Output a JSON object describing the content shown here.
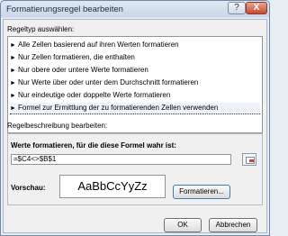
{
  "window": {
    "title": "Formatierungsregel bearbeiten",
    "help": "?",
    "close": "X"
  },
  "rule_type": {
    "label": "Regeltyp auswählen:",
    "items": [
      {
        "label": "Alle Zellen basierend auf ihren Werten formatieren"
      },
      {
        "label": "Nur Zellen formatieren, die enthalten"
      },
      {
        "label": "Nur obere oder untere Werte formatieren"
      },
      {
        "label": "Nur Werte über oder unter dem Durchschnitt formatieren"
      },
      {
        "label": "Nur eindeutige oder doppelte Werte formatieren"
      },
      {
        "label": "Formel zur Ermittlung der zu formatierenden Zellen verwenden",
        "selected": true
      }
    ]
  },
  "description": {
    "label": "Regelbeschreibung bearbeiten:",
    "formula_label": "Werte formatieren, für die diese Formel wahr ist:",
    "formula_value": "=$C4<>$B$1",
    "preview_label": "Vorschau:",
    "preview_text": "AaBbCcYyZz",
    "format_button": "Formatieren..."
  },
  "buttons": {
    "ok": "OK",
    "cancel": "Abbrechen"
  },
  "icons": {
    "collapse_dialog": "range-selector-icon",
    "arrow": "right-triangle-icon"
  }
}
